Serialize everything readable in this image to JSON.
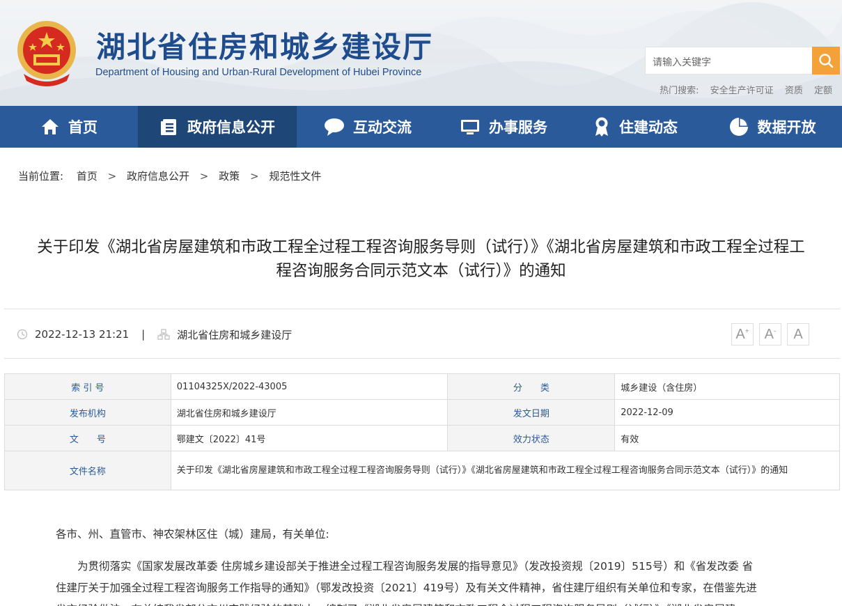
{
  "header": {
    "title_cn": "湖北省住房和城乡建设厅",
    "title_en": "Department of Housing and Urban-Rural Development of Hubei Province",
    "search_placeholder": "请输入关键字",
    "hot_search_label": "热门搜索:",
    "hot_search_items": [
      "安全生产许可证",
      "资质",
      "定额"
    ]
  },
  "nav": {
    "items": [
      {
        "label": "首页",
        "icon": "home-icon"
      },
      {
        "label": "政府信息公开",
        "icon": "document-list-icon",
        "active": true
      },
      {
        "label": "互动交流",
        "icon": "chat-bubble-icon"
      },
      {
        "label": "办事服务",
        "icon": "monitor-icon"
      },
      {
        "label": "住建动态",
        "icon": "award-ribbon-icon"
      },
      {
        "label": "数据开放",
        "icon": "pie-chart-icon"
      }
    ],
    "colors": {
      "bar": "#2a5a99",
      "active": "#1e4777"
    }
  },
  "breadcrumb": {
    "label": "当前位置:",
    "items": [
      "首页",
      "政府信息公开",
      "政策",
      "规范性文件"
    ],
    "separator": ">"
  },
  "article": {
    "title_line1": "关于印发《湖北省房屋建筑和市政工程全过程工程咨询服务导则（试行）》《湖北省房屋建筑和市政工程全过程工",
    "title_line2": "程咨询服务合同示范文本（试行）》的通知",
    "datetime": "2022-12-13 21:21",
    "separator": "|",
    "source": "湖北省住房和城乡建设厅",
    "font_controls": [
      "A+",
      "A-",
      "A"
    ]
  },
  "info": {
    "rows": [
      {
        "k1": "索 引 号",
        "v1": "01104325X/2022-43005",
        "k2": "分　　类",
        "v2": "城乡建设（含住房）"
      },
      {
        "k1": "发布机构",
        "v1": "湖北省住房和城乡建设厅",
        "k2": "发文日期",
        "v2": "2022-12-09"
      },
      {
        "k1": "文　　号",
        "v1": "鄂建文〔2022〕41号",
        "k2": "效力状态",
        "v2": "有效"
      }
    ],
    "file_name_label": "文件名称",
    "file_name": "关于印发《湖北省房屋建筑和市政工程全过程工程咨询服务导则（试行）》《湖北省房屋建筑和市政工程全过程工程咨询服务合同示范文本（试行）》的通知"
  },
  "body": {
    "greeting": "各市、州、直管市、神农架林区住（城）建局，有关单位:",
    "para1_line1": "为贯彻落实《国家发展改革委 住房城乡建设部关于推进全过程工程咨询服务发展的指导意见》（发改投资规〔2019〕515号）和《省发改委 省",
    "para1_line2": "住建厅关于加强全过程工程咨询服务工作指导的通知》（鄂发改投资〔2021〕419号）及有关文件精神，省住建厅组织有关单位和专家，在借鉴先进",
    "para1_line3": "省市经验做法，在总结我省部分市州实践经验的基础上，编制了《湖北省房屋建筑和市政工程全过程工程咨询服务导则（试行）》《湖北省房屋建"
  }
}
